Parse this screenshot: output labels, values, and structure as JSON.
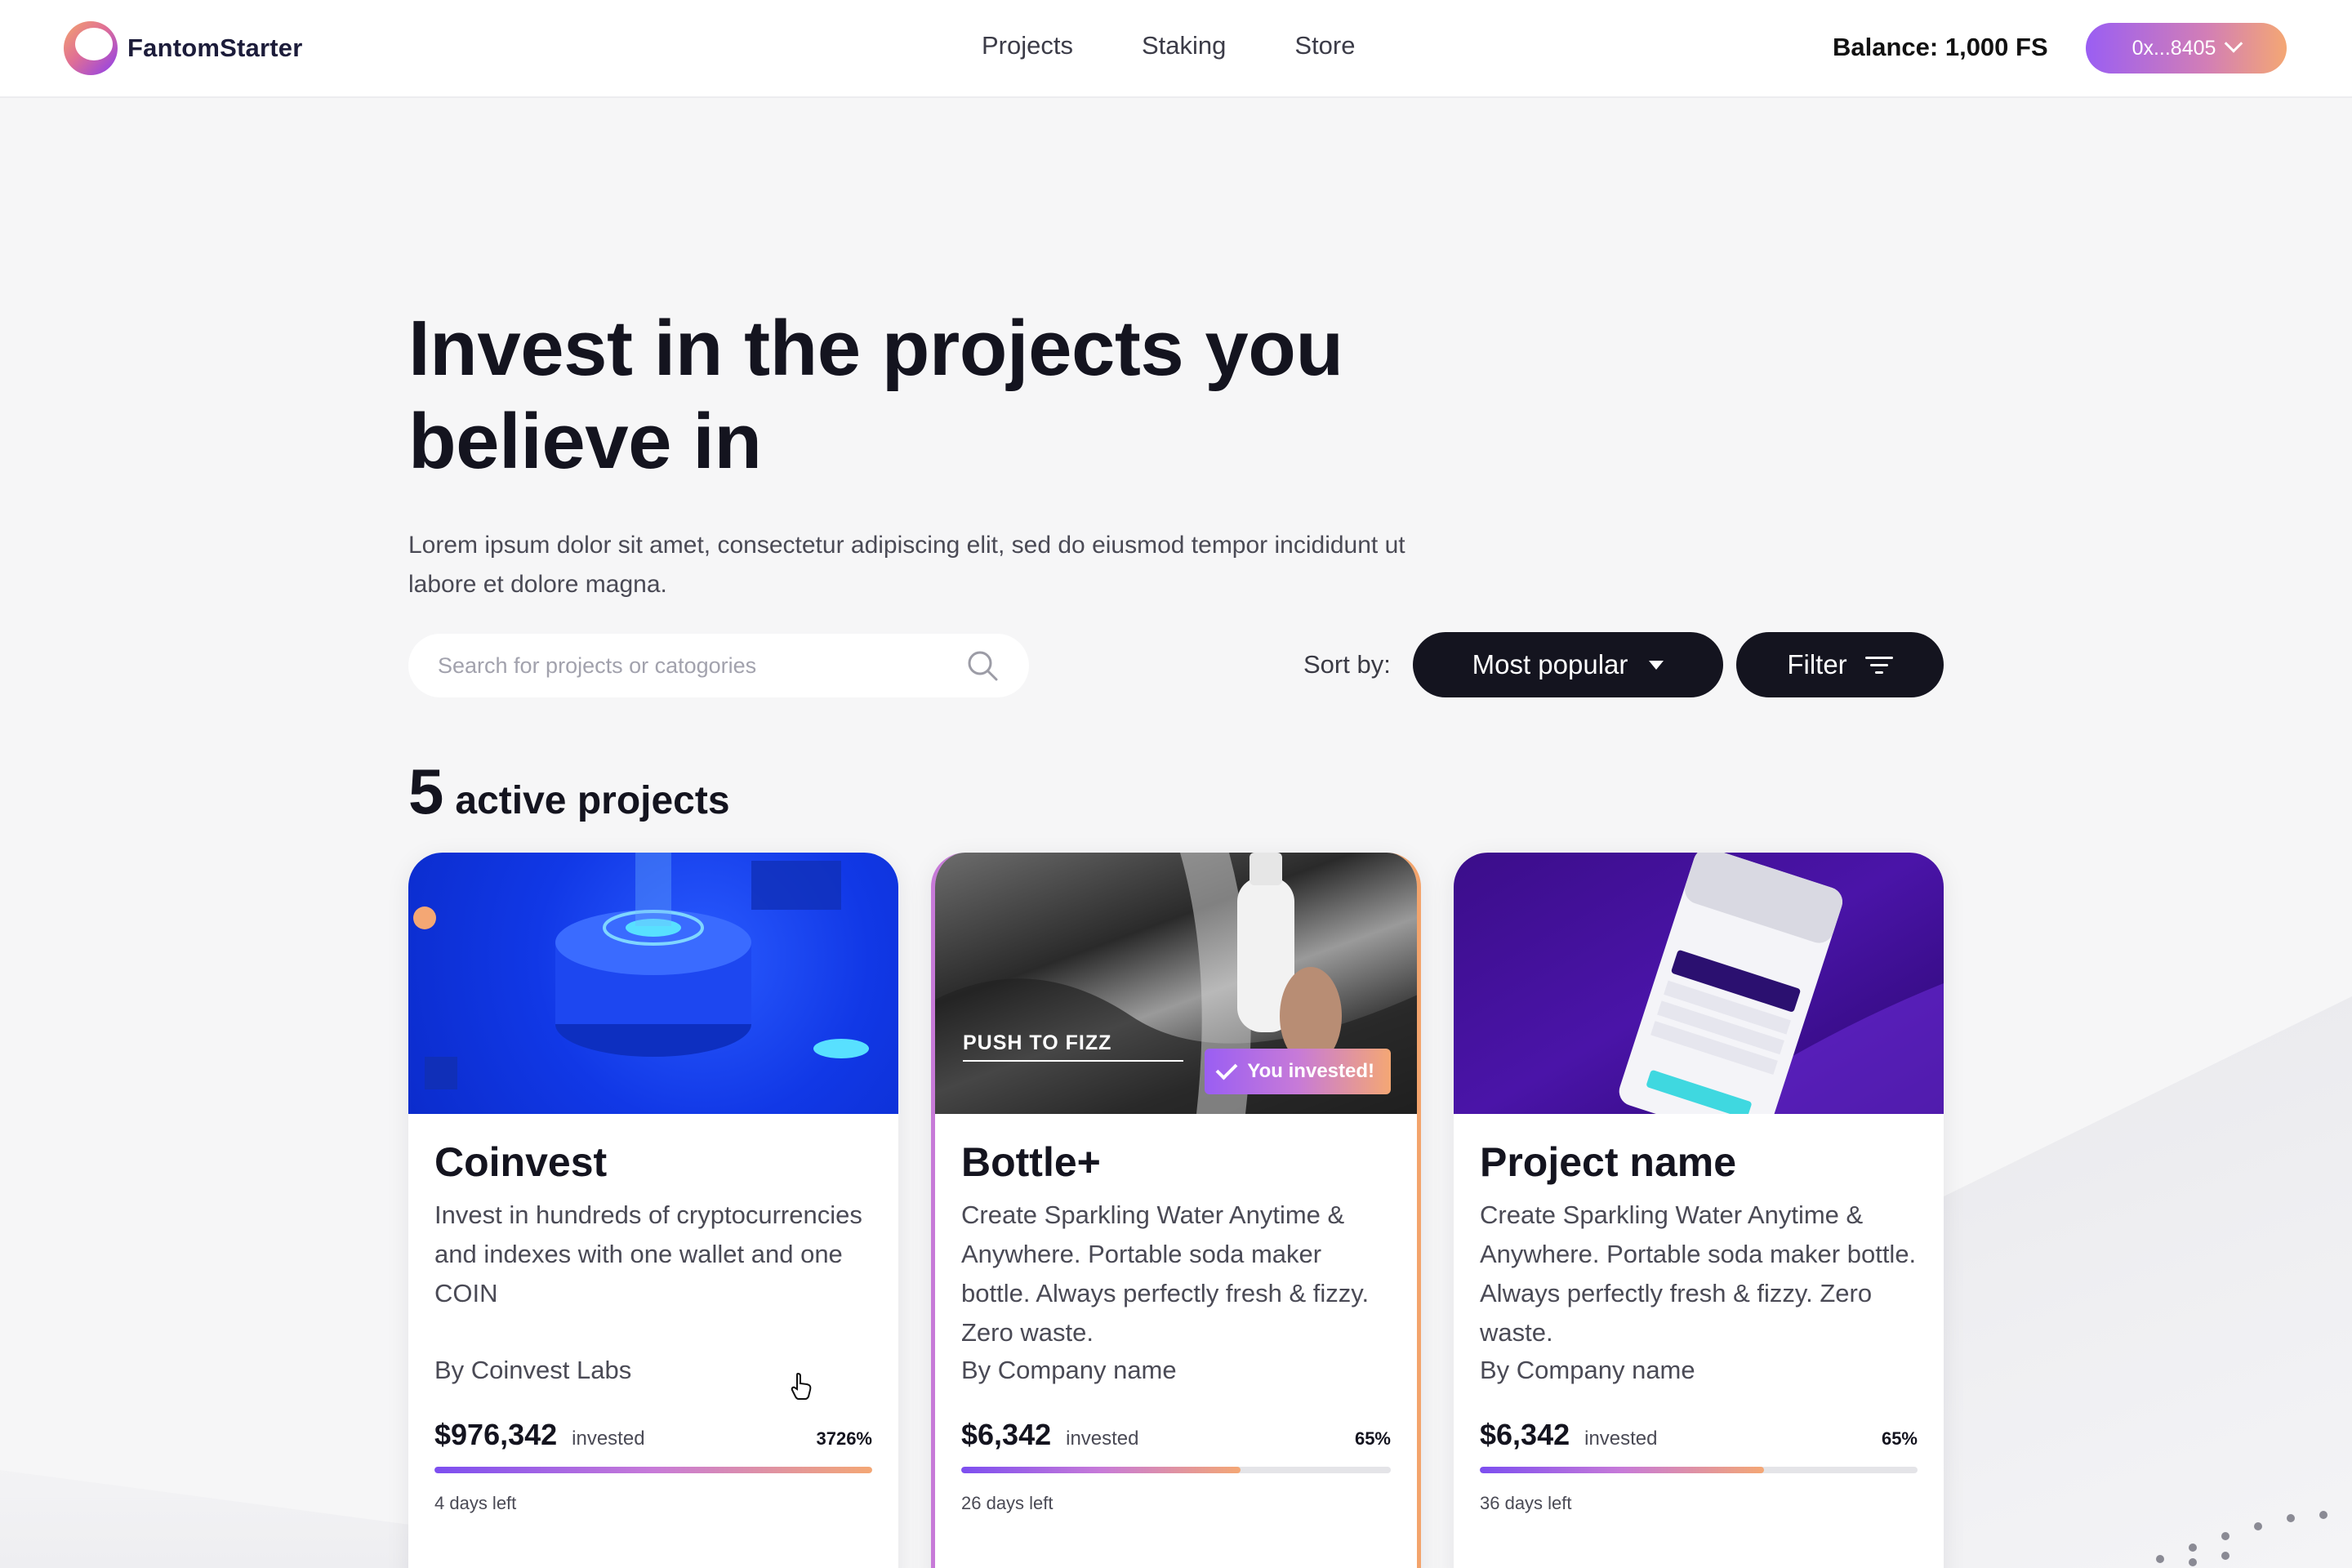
{
  "header": {
    "brand": "FantomStarter",
    "nav": [
      "Projects",
      "Staking",
      "Store"
    ],
    "balance": "Balance: 1,000 FS",
    "wallet": "0x...8405"
  },
  "hero": {
    "title": "Invest in the projects you believe in",
    "subtitle": "Lorem ipsum dolor sit amet, consectetur adipiscing elit, sed do eiusmod tempor incididunt ut labore et dolore magna."
  },
  "controls": {
    "search_placeholder": "Search for projects or catogories",
    "sort_label": "Sort by:",
    "sort_value": "Most popular",
    "filter_label": "Filter"
  },
  "projects_count": {
    "number": "5",
    "label": "active projects"
  },
  "cards": [
    {
      "title": "Coinvest",
      "description": "Invest in hundreds of cryptocurrencies and indexes with one wallet and one COIN",
      "by": "By Coinvest Labs",
      "amount": "$976,342",
      "invested_label": "invested",
      "percent": "3726%",
      "progress": 1.0,
      "days_left": "4 days left"
    },
    {
      "title": "Bottle+",
      "description": "Create Sparkling Water Anytime & Anywhere. Portable soda maker bottle. Always perfectly fresh & fizzy. Zero waste.",
      "by": "By Company name",
      "amount": "$6,342",
      "invested_label": "invested",
      "percent": "65%",
      "progress": 0.65,
      "days_left": "26 days left",
      "image_caption": "PUSH TO FIZZ",
      "badge": "You invested!"
    },
    {
      "title": "Project name",
      "description": "Create Sparkling Water Anytime & Anywhere. Portable soda maker bottle. Always perfectly fresh & fizzy. Zero waste.",
      "by": "By Company name",
      "amount": "$6,342",
      "invested_label": "invested",
      "percent": "65%",
      "progress": 0.65,
      "days_left": "36 days left"
    }
  ],
  "colors": {
    "accent_start": "#9a5ef3",
    "accent_end": "#f4a774",
    "dark": "#14141f"
  }
}
